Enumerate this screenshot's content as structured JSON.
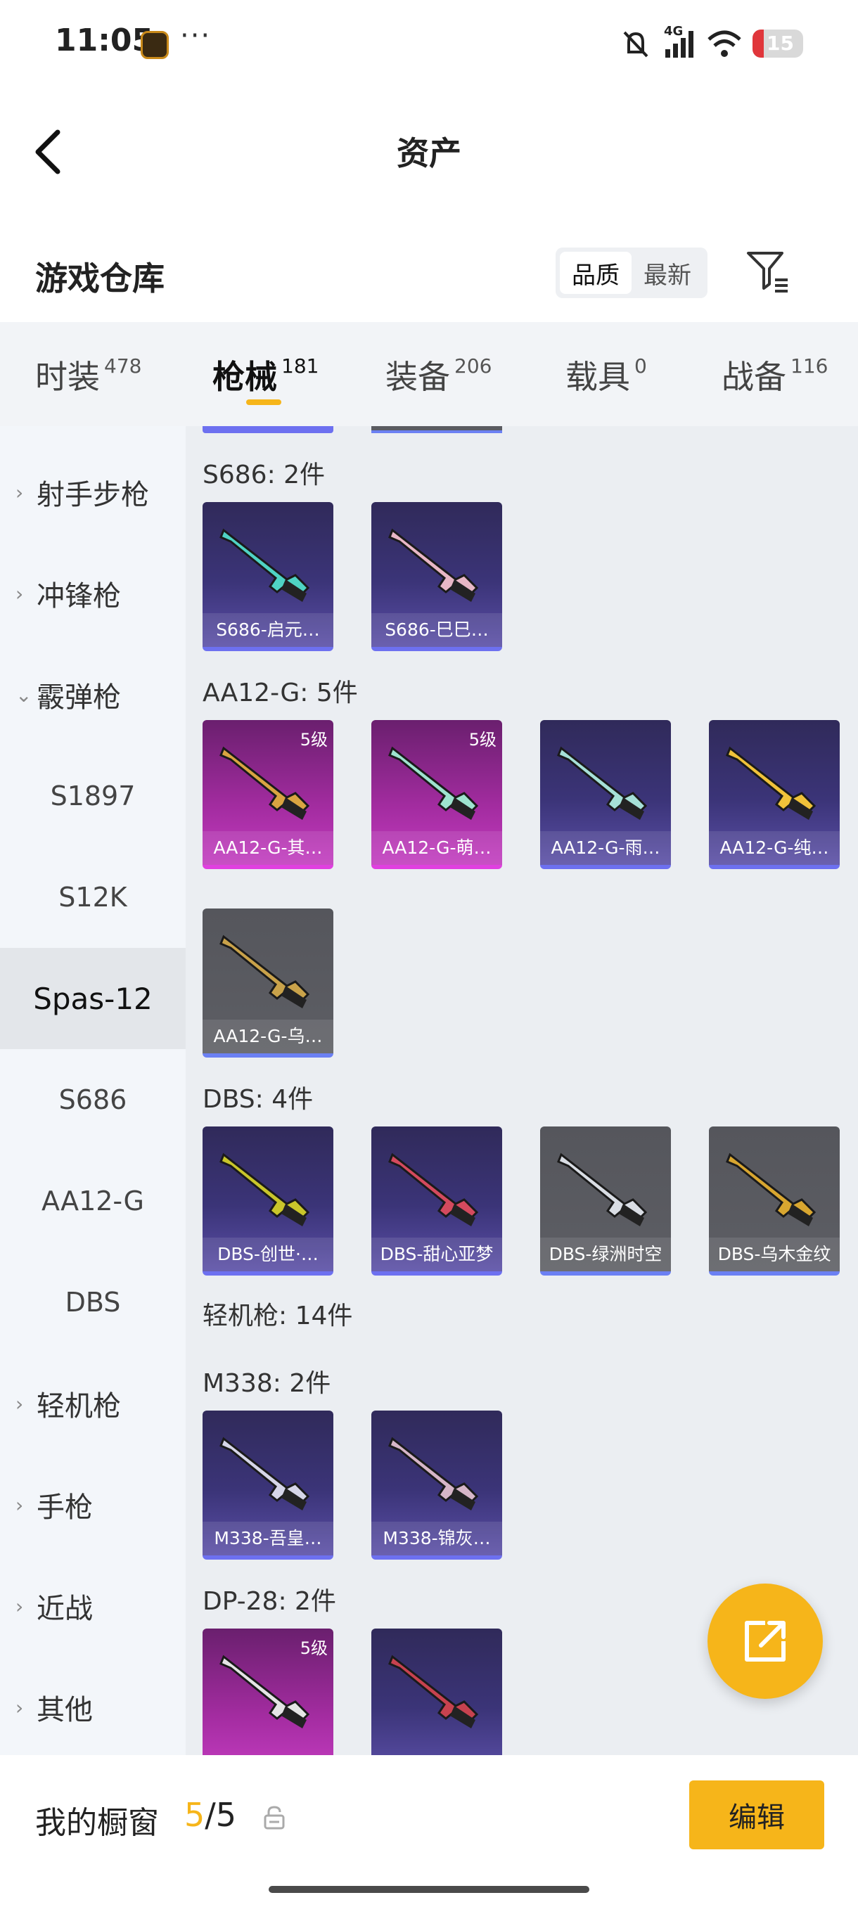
{
  "status_bar": {
    "time": "11:05",
    "dots": "···",
    "network": "4G",
    "battery": "15"
  },
  "header": {
    "title": "资产"
  },
  "warehouse": {
    "title": "游戏仓库",
    "sort_options": [
      "品质",
      "最新"
    ],
    "active_sort": "品质"
  },
  "top_tabs": [
    {
      "label": "时装",
      "count": "478"
    },
    {
      "label": "枪械",
      "count": "181",
      "active": true
    },
    {
      "label": "装备",
      "count": "206"
    },
    {
      "label": "载具",
      "count": "0"
    },
    {
      "label": "战备",
      "count": "116"
    }
  ],
  "sidebar": [
    {
      "label": "射手步枪",
      "type": "category",
      "chevron": "›"
    },
    {
      "label": "冲锋枪",
      "type": "category",
      "chevron": "›"
    },
    {
      "label": "霰弹枪",
      "type": "category",
      "chevron": "⌄",
      "expanded": true
    },
    {
      "label": "S1897",
      "type": "sub"
    },
    {
      "label": "S12K",
      "type": "sub"
    },
    {
      "label": "Spas-12",
      "type": "sub",
      "selected": true
    },
    {
      "label": "S686",
      "type": "sub"
    },
    {
      "label": "AA12-G",
      "type": "sub"
    },
    {
      "label": "DBS",
      "type": "sub"
    },
    {
      "label": "轻机枪",
      "type": "category",
      "chevron": "›"
    },
    {
      "label": "手枪",
      "type": "category",
      "chevron": "›"
    },
    {
      "label": "近战",
      "type": "category",
      "chevron": "›"
    },
    {
      "label": "其他",
      "type": "category",
      "chevron": "›"
    }
  ],
  "groups": [
    {
      "label": "S686: 2件"
    },
    {
      "label": "AA12-G: 5件"
    },
    {
      "label": "DBS: 4件"
    },
    {
      "label": "轻机枪: 14件"
    },
    {
      "label": "M338: 2件"
    },
    {
      "label": "DP-28: 2件"
    }
  ],
  "cards": [
    {
      "name": "S686-启元…",
      "rarity": "blue",
      "level": ""
    },
    {
      "name": "S686-巳巳…",
      "rarity": "blue",
      "level": ""
    },
    {
      "name": "AA12-G-其…",
      "rarity": "pink",
      "level": "5级"
    },
    {
      "name": "AA12-G-萌…",
      "rarity": "pink",
      "level": "5级"
    },
    {
      "name": "AA12-G-雨…",
      "rarity": "blue",
      "level": ""
    },
    {
      "name": "AA12-G-纯…",
      "rarity": "blue",
      "level": ""
    },
    {
      "name": "AA12-G-乌…",
      "rarity": "gray",
      "level": ""
    },
    {
      "name": "DBS-创世·…",
      "rarity": "blue",
      "level": ""
    },
    {
      "name": "DBS-甜心亚梦",
      "rarity": "blue",
      "level": ""
    },
    {
      "name": "DBS-绿洲时空",
      "rarity": "gray",
      "level": ""
    },
    {
      "name": "DBS-乌木金纹",
      "rarity": "gray",
      "level": ""
    },
    {
      "name": "M338-吾皇…",
      "rarity": "blue",
      "level": ""
    },
    {
      "name": "M338-锦灰…",
      "rarity": "blue",
      "level": ""
    },
    {
      "name": "",
      "rarity": "pink",
      "level": "5级"
    },
    {
      "name": "",
      "rarity": "blue",
      "level": ""
    }
  ],
  "bottom_bar": {
    "label": "我的橱窗",
    "current": "5",
    "separator": "/",
    "max": "5",
    "edit_label": "编辑"
  },
  "colors": {
    "accent": "#f6b51a",
    "blue_quality": "#6d70f0",
    "pink_quality": "#e040e0"
  }
}
